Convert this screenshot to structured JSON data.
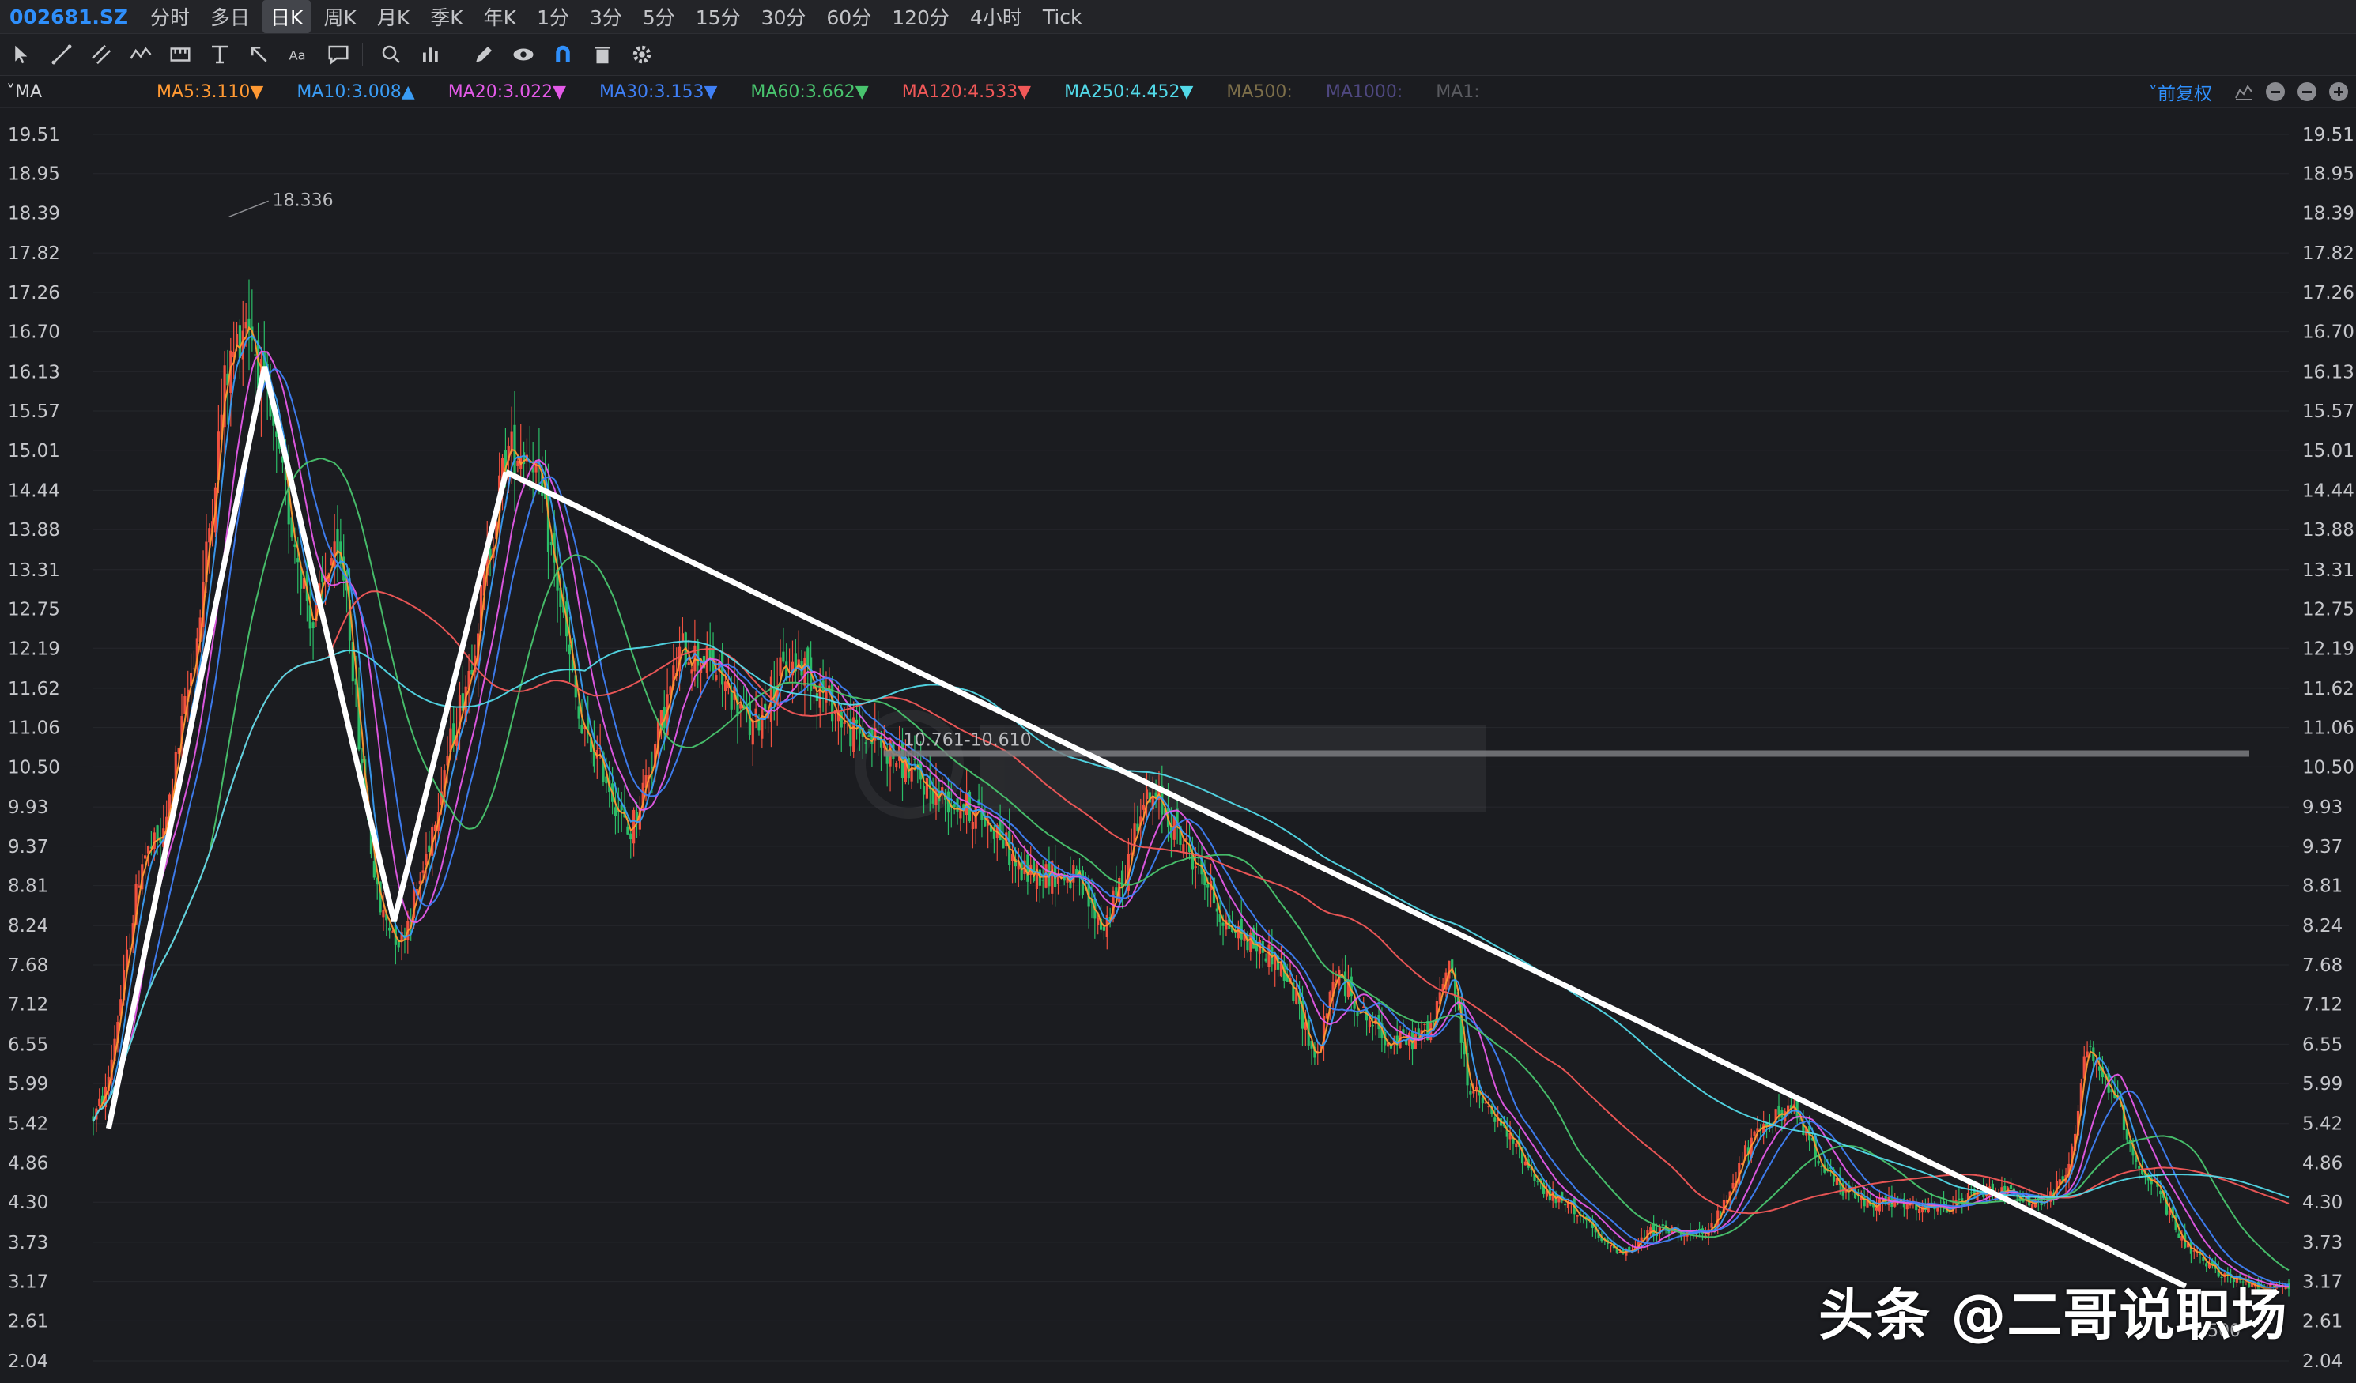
{
  "topbar": {
    "ticker": "002681.SZ",
    "periods": [
      "分时",
      "多日",
      "日K",
      "周K",
      "月K",
      "季K",
      "年K",
      "1分",
      "3分",
      "5分",
      "15分",
      "30分",
      "60分",
      "120分",
      "4小时",
      "Tick"
    ],
    "active_period": "日K"
  },
  "toolbar": {
    "icons": [
      "cursor-icon",
      "line-draw-icon",
      "channel-icon",
      "wave-icon",
      "measure-icon",
      "text-align-icon",
      "arrow-icon",
      "text-icon",
      "comment-icon",
      "search-icon",
      "magnet-bars-icon",
      "pen-icon",
      "eye-icon",
      "magnet-icon",
      "trash-icon",
      "gear-icon"
    ]
  },
  "ma_bar": {
    "title": "MA",
    "items": [
      {
        "label": "MA5:3.110",
        "arrow": "▼",
        "color": "#ff9933"
      },
      {
        "label": "MA10:3.008",
        "arrow": "▲",
        "color": "#3a9cf4"
      },
      {
        "label": "MA20:3.022",
        "arrow": "▼",
        "color": "#e45ae8"
      },
      {
        "label": "MA30:3.153",
        "arrow": "▼",
        "color": "#3f7ff5"
      },
      {
        "label": "MA60:3.662",
        "arrow": "▼",
        "color": "#49c46e"
      },
      {
        "label": "MA120:4.533",
        "arrow": "▼",
        "color": "#f25858"
      },
      {
        "label": "MA250:4.452",
        "arrow": "▼",
        "color": "#52d9e8"
      },
      {
        "label": "MA500:",
        "arrow": "",
        "color": "#7d6f4a"
      },
      {
        "label": "MA1000:",
        "arrow": "",
        "color": "#4f4880"
      },
      {
        "label": "MA1:",
        "arrow": "",
        "color": "#5a5b60"
      }
    ],
    "adjust_label": "前复权"
  },
  "chart_data": {
    "type": "candlestick",
    "yticks": [
      "19.51",
      "18.95",
      "18.39",
      "17.82",
      "17.26",
      "16.70",
      "16.13",
      "15.57",
      "15.01",
      "14.44",
      "13.88",
      "13.31",
      "12.75",
      "12.19",
      "11.62",
      "11.06",
      "10.50",
      "9.93",
      "9.37",
      "8.81",
      "8.24",
      "7.68",
      "7.12",
      "6.55",
      "5.99",
      "5.42",
      "4.86",
      "4.30",
      "3.73",
      "3.17",
      "2.61",
      "2.04"
    ],
    "ylim": [
      2.04,
      19.51
    ],
    "x_start": 0,
    "x_end": 1000,
    "price_path": [
      [
        0,
        5.5
      ],
      [
        6,
        5.9
      ],
      [
        14,
        7.5
      ],
      [
        22,
        9.2
      ],
      [
        32,
        9.5
      ],
      [
        48,
        12.5
      ],
      [
        60,
        16.0
      ],
      [
        70,
        17.0
      ],
      [
        80,
        15.5
      ],
      [
        90,
        14.0
      ],
      [
        100,
        12.5
      ],
      [
        108,
        13.5
      ],
      [
        115,
        13.2
      ],
      [
        122,
        10.5
      ],
      [
        130,
        8.5
      ],
      [
        140,
        8.0
      ],
      [
        150,
        9.0
      ],
      [
        160,
        10.5
      ],
      [
        172,
        12.0
      ],
      [
        180,
        13.5
      ],
      [
        188,
        15.0
      ],
      [
        200,
        15.0
      ],
      [
        212,
        13.0
      ],
      [
        222,
        11.0
      ],
      [
        232,
        10.5
      ],
      [
        244,
        9.5
      ],
      [
        256,
        10.8
      ],
      [
        268,
        12.2
      ],
      [
        280,
        12.0
      ],
      [
        292,
        11.5
      ],
      [
        300,
        11.0
      ],
      [
        312,
        11.8
      ],
      [
        322,
        12.0
      ],
      [
        334,
        11.5
      ],
      [
        345,
        11.0
      ],
      [
        356,
        10.9
      ],
      [
        370,
        10.5
      ],
      [
        385,
        10.1
      ],
      [
        400,
        9.9
      ],
      [
        412,
        9.6
      ],
      [
        422,
        9.0
      ],
      [
        435,
        9.0
      ],
      [
        447,
        8.9
      ],
      [
        460,
        8.2
      ],
      [
        470,
        9.0
      ],
      [
        477,
        10.0
      ],
      [
        485,
        10.0
      ],
      [
        495,
        9.5
      ],
      [
        505,
        9.0
      ],
      [
        515,
        8.3
      ],
      [
        527,
        8.0
      ],
      [
        538,
        7.8
      ],
      [
        548,
        7.2
      ],
      [
        557,
        6.3
      ],
      [
        566,
        7.6
      ],
      [
        578,
        7.0
      ],
      [
        590,
        6.6
      ],
      [
        600,
        6.6
      ],
      [
        610,
        6.8
      ],
      [
        618,
        7.8
      ],
      [
        626,
        6.0
      ],
      [
        638,
        5.5
      ],
      [
        650,
        5.0
      ],
      [
        662,
        4.4
      ],
      [
        675,
        4.2
      ],
      [
        688,
        3.7
      ],
      [
        700,
        3.6
      ],
      [
        710,
        3.9
      ],
      [
        722,
        3.9
      ],
      [
        734,
        3.8
      ],
      [
        742,
        4.2
      ],
      [
        752,
        5.0
      ],
      [
        764,
        5.5
      ],
      [
        775,
        5.6
      ],
      [
        785,
        5.0
      ],
      [
        795,
        4.5
      ],
      [
        808,
        4.3
      ],
      [
        820,
        4.3
      ],
      [
        832,
        4.2
      ],
      [
        845,
        4.2
      ],
      [
        856,
        4.4
      ],
      [
        868,
        4.5
      ],
      [
        880,
        4.3
      ],
      [
        890,
        4.3
      ],
      [
        900,
        4.8
      ],
      [
        908,
        6.5
      ],
      [
        914,
        6.1
      ],
      [
        920,
        5.9
      ],
      [
        930,
        4.9
      ],
      [
        940,
        4.5
      ],
      [
        950,
        3.8
      ],
      [
        962,
        3.4
      ],
      [
        975,
        3.2
      ],
      [
        990,
        3.1
      ],
      [
        1000,
        3.1
      ]
    ],
    "ma_series": [
      {
        "color": "#ff9933",
        "window": 5
      },
      {
        "color": "#3a9cf4",
        "window": 10
      },
      {
        "color": "#e45ae8",
        "window": 20
      },
      {
        "color": "#3f7ff5",
        "window": 30
      },
      {
        "color": "#49c46e",
        "window": 60
      },
      {
        "color": "#f25858",
        "window": 120
      },
      {
        "color": "#52d9e8",
        "window": 250
      }
    ],
    "annotation_lines": [
      {
        "name": "zigzag",
        "points": [
          [
            7,
            5.35
          ],
          [
            78,
            16.2
          ],
          [
            137,
            8.3
          ],
          [
            188,
            14.7
          ]
        ]
      },
      {
        "name": "downtrend",
        "points": [
          [
            188,
            14.7
          ],
          [
            953,
            3.1
          ]
        ]
      }
    ],
    "horizontal_band": {
      "value": 10.69,
      "x_from": 360,
      "x_to": 1000,
      "label": "10.761-10.610"
    },
    "high_label": {
      "x": 60,
      "value": 18.336,
      "text": "18.336"
    },
    "low_label": {
      "x": 968,
      "value": 2.5,
      "text": "2.500"
    }
  },
  "watermark": {
    "text": "头条 @二哥说职场"
  }
}
